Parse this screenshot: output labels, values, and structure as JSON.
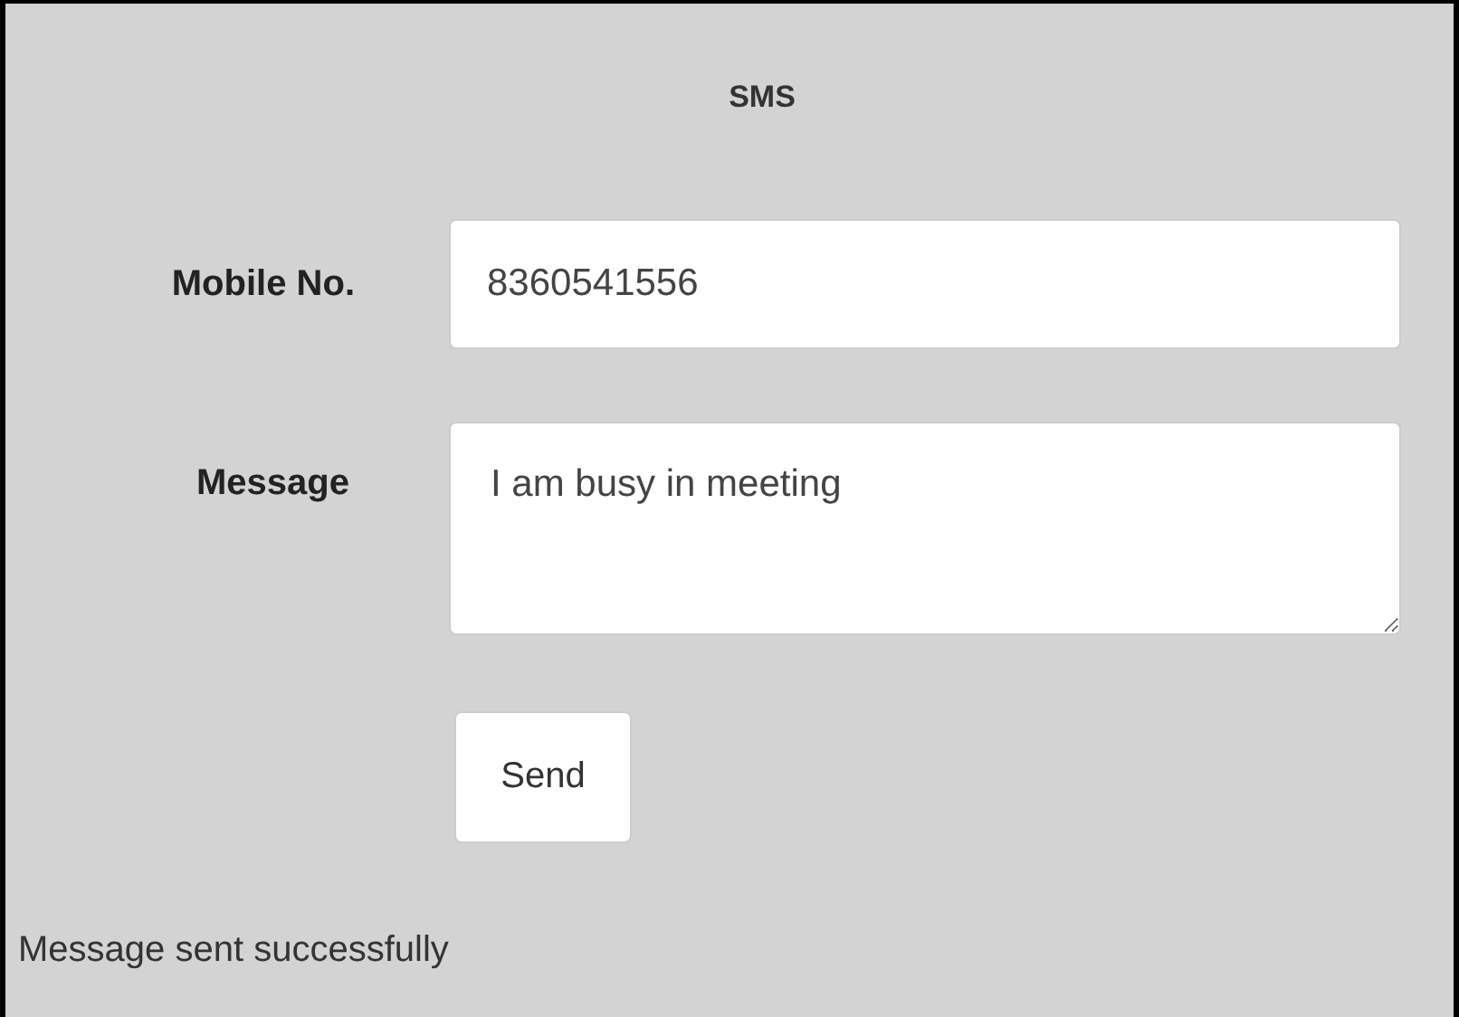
{
  "title": "SMS",
  "fields": [
    {
      "label": "Mobile No.",
      "value": "8360541556",
      "kind": "text"
    },
    {
      "label": "Message",
      "value": "I am busy in meeting",
      "kind": "textarea"
    }
  ],
  "button": "Send",
  "status": "Message sent successfully"
}
